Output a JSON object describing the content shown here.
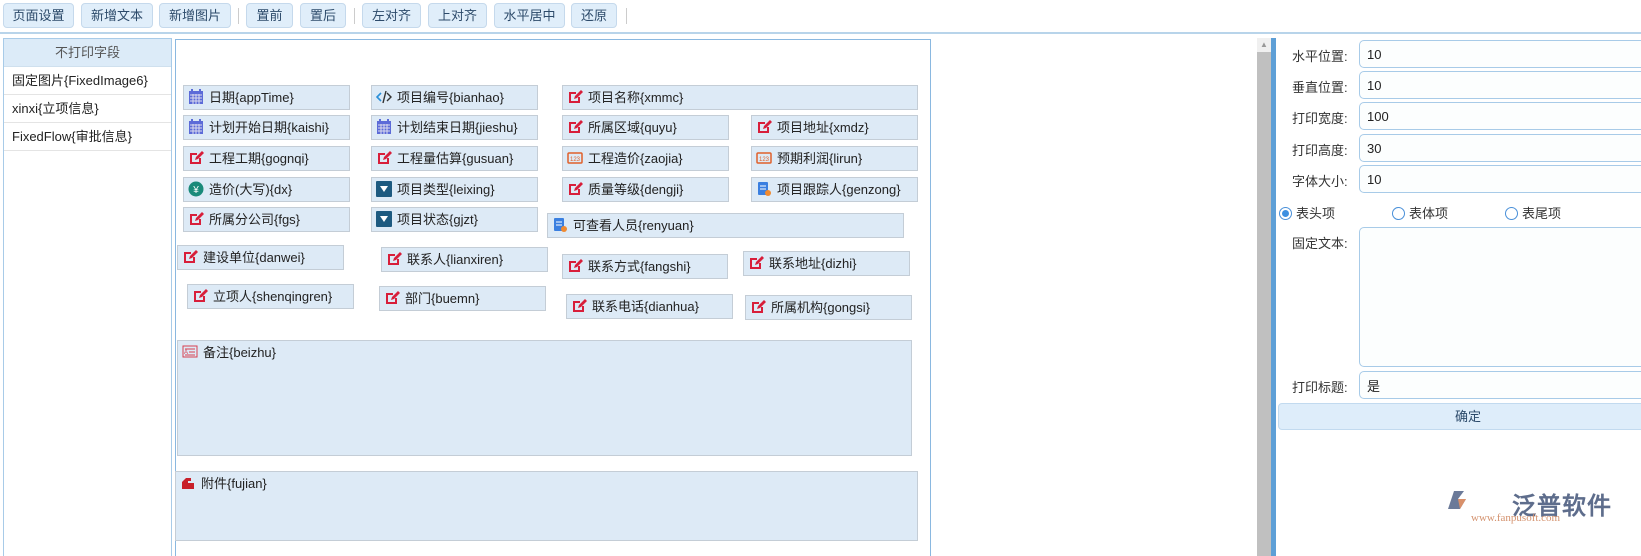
{
  "toolbar": {
    "buttons": [
      "页面设置",
      "新增文本",
      "新增图片",
      "置前",
      "置后",
      "左对齐",
      "上对齐",
      "水平居中",
      "还原"
    ]
  },
  "left_panel": {
    "title": "不打印字段",
    "items": [
      "固定图片{FixedImage6}",
      "xinxi{立项信息}",
      "FixedFlow{审批信息}"
    ]
  },
  "fields": [
    {
      "label": "日期{appTime}",
      "icon": "calendar"
    },
    {
      "label": "项目编号{bianhao}",
      "icon": "code"
    },
    {
      "label": "项目名称{xmmc}",
      "icon": "edit"
    },
    {
      "label": "计划开始日期{kaishi}",
      "icon": "calendar"
    },
    {
      "label": "计划结束日期{jieshu}",
      "icon": "calendar"
    },
    {
      "label": "所属区域{quyu}",
      "icon": "edit"
    },
    {
      "label": "项目地址{xmdz}",
      "icon": "edit"
    },
    {
      "label": "工程工期{gognqi}",
      "icon": "edit"
    },
    {
      "label": "工程量估算{gusuan}",
      "icon": "edit"
    },
    {
      "label": "工程造价{zaojia}",
      "icon": "number"
    },
    {
      "label": "预期利润{lirun}",
      "icon": "number"
    },
    {
      "label": "造价(大写){dx}",
      "icon": "money"
    },
    {
      "label": "项目类型{leixing}",
      "icon": "dropdown"
    },
    {
      "label": "质量等级{dengji}",
      "icon": "edit"
    },
    {
      "label": "项目跟踪人{genzong}",
      "icon": "user"
    },
    {
      "label": "所属分公司{fgs}",
      "icon": "edit"
    },
    {
      "label": "项目状态{gjzt}",
      "icon": "dropdown"
    },
    {
      "label": "可查看人员{renyuan}",
      "icon": "user"
    },
    {
      "label": "建设单位{danwei}",
      "icon": "edit"
    },
    {
      "label": "联系人{lianxiren}",
      "icon": "edit"
    },
    {
      "label": "联系方式{fangshi}",
      "icon": "edit"
    },
    {
      "label": "联系地址{dizhi}",
      "icon": "edit"
    },
    {
      "label": "立项人{shenqingren}",
      "icon": "edit"
    },
    {
      "label": "部门{buemn}",
      "icon": "edit"
    },
    {
      "label": "联系电话{dianhua}",
      "icon": "edit"
    },
    {
      "label": "所属机构{gongsi}",
      "icon": "edit"
    },
    {
      "label": "备注{beizhu}",
      "icon": "textarea"
    },
    {
      "label": "附件{fujian}",
      "icon": "attachment"
    }
  ],
  "props": {
    "x_label": "水平位置:",
    "x_value": "10",
    "y_label": "垂直位置:",
    "y_value": "10",
    "w_label": "打印宽度:",
    "w_value": "100",
    "h_label": "打印高度:",
    "h_value": "30",
    "font_label": "字体大小:",
    "font_value": "10",
    "radios": [
      {
        "label": "表头项",
        "checked": true
      },
      {
        "label": "表体项",
        "checked": false
      },
      {
        "label": "表尾项",
        "checked": false
      }
    ],
    "text_label": "固定文本:",
    "text_value": "",
    "title_label": "打印标题:",
    "title_value": "是",
    "confirm": "确定"
  },
  "logo": {
    "name": "泛普软件",
    "url": "www.fanpusoft.com"
  }
}
